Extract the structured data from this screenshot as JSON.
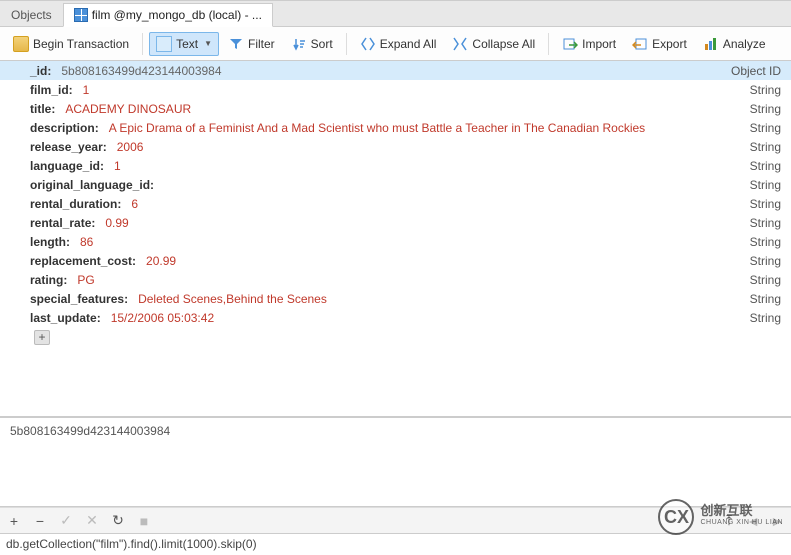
{
  "tabs": {
    "inactive_label": "Objects",
    "active_label": "film @my_mongo_db (local) - ..."
  },
  "toolbar": {
    "begin_tx": "Begin Transaction",
    "text_mode": "Text",
    "filter": "Filter",
    "sort": "Sort",
    "expand_all": "Expand All",
    "collapse_all": "Collapse All",
    "import": "Import",
    "export": "Export",
    "analyze": "Analyze"
  },
  "doc": {
    "fields": [
      {
        "key": "_id",
        "value": "5b808163499d423144003984",
        "type": "Object ID",
        "selected": true,
        "idstyle": true
      },
      {
        "key": "film_id",
        "value": "1",
        "type": "String"
      },
      {
        "key": "title",
        "value": "ACADEMY DINOSAUR",
        "type": "String"
      },
      {
        "key": "description",
        "value": "A Epic Drama of a Feminist And a Mad Scientist who must Battle a Teacher in The Canadian Rockies",
        "type": "String"
      },
      {
        "key": "release_year",
        "value": "2006",
        "type": "String"
      },
      {
        "key": "language_id",
        "value": "1",
        "type": "String"
      },
      {
        "key": "original_language_id",
        "value": "",
        "type": "String"
      },
      {
        "key": "rental_duration",
        "value": "6",
        "type": "String"
      },
      {
        "key": "rental_rate",
        "value": "0.99",
        "type": "String"
      },
      {
        "key": "length",
        "value": "86",
        "type": "String"
      },
      {
        "key": "replacement_cost",
        "value": "20.99",
        "type": "String"
      },
      {
        "key": "rating",
        "value": "PG",
        "type": "String"
      },
      {
        "key": "special_features",
        "value": "Deleted Scenes,Behind the Scenes",
        "type": "String"
      },
      {
        "key": "last_update",
        "value": "15/2/2006 05:03:42",
        "type": "String"
      }
    ],
    "plus_label": "+"
  },
  "preview_id": "5b808163499d423144003984",
  "bottom": {
    "add": "+",
    "remove": "−",
    "check": "✓",
    "close": "✕",
    "refresh": "↻",
    "stop": "■",
    "goto_top": "⤒",
    "page_left": "◄",
    "page_right": "►"
  },
  "query": "db.getCollection(\"film\").find().limit(1000).skip(0)",
  "watermark": {
    "logo": "CX",
    "line1": "创新互联",
    "line2": "CHUANG XIN HU LIAN"
  }
}
